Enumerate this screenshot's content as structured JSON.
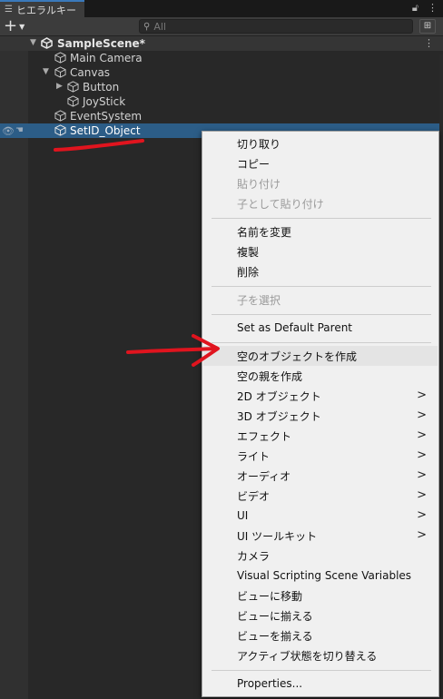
{
  "tab": {
    "title": "ヒエラルキー",
    "icon": "hamburger-icon",
    "lock_icon": "lock-icon",
    "menu_icon": "kebab-icon"
  },
  "toolbar": {
    "add_label": "+",
    "search_placeholder": "All",
    "search_icon": "search-icon",
    "filter_icon": "filter-icon"
  },
  "hierarchy": {
    "scene": "SampleScene*",
    "items": [
      {
        "label": "Main Camera"
      },
      {
        "label": "Canvas"
      },
      {
        "label": "Button"
      },
      {
        "label": "JoyStick"
      },
      {
        "label": "EventSystem"
      },
      {
        "label": "SetID_Object",
        "selected": true
      }
    ]
  },
  "context_menu": {
    "items": [
      {
        "label": "切り取り",
        "enabled": true
      },
      {
        "label": "コピー",
        "enabled": true
      },
      {
        "label": "貼り付け",
        "enabled": false
      },
      {
        "label": "子として貼り付け",
        "enabled": false
      },
      {
        "label": "名前を変更",
        "enabled": true
      },
      {
        "label": "複製",
        "enabled": true
      },
      {
        "label": "削除",
        "enabled": true
      },
      {
        "label": "子を選択",
        "enabled": false
      },
      {
        "label": "Set as Default Parent",
        "enabled": true
      },
      {
        "label": "空のオブジェクトを作成",
        "enabled": true,
        "highlighted": true
      },
      {
        "label": "空の親を作成",
        "enabled": true
      },
      {
        "label": "2D オブジェクト",
        "submenu": true
      },
      {
        "label": "3D オブジェクト",
        "submenu": true
      },
      {
        "label": "エフェクト",
        "submenu": true
      },
      {
        "label": "ライト",
        "submenu": true
      },
      {
        "label": "オーディオ",
        "submenu": true
      },
      {
        "label": "ビデオ",
        "submenu": true
      },
      {
        "label": "UI",
        "submenu": true
      },
      {
        "label": "UI ツールキット",
        "submenu": true
      },
      {
        "label": "カメラ"
      },
      {
        "label": "Visual Scripting Scene Variables"
      },
      {
        "label": "ビューに移動"
      },
      {
        "label": "ビューに揃える"
      },
      {
        "label": "ビューを揃える"
      },
      {
        "label": "アクティブ状態を切り替える"
      },
      {
        "label": "Properties..."
      }
    ],
    "submenu_glyph": ">"
  },
  "colors": {
    "selection": "#2c5d87",
    "annotation": "#e0141e",
    "menu_bg": "#f0f0f0"
  }
}
